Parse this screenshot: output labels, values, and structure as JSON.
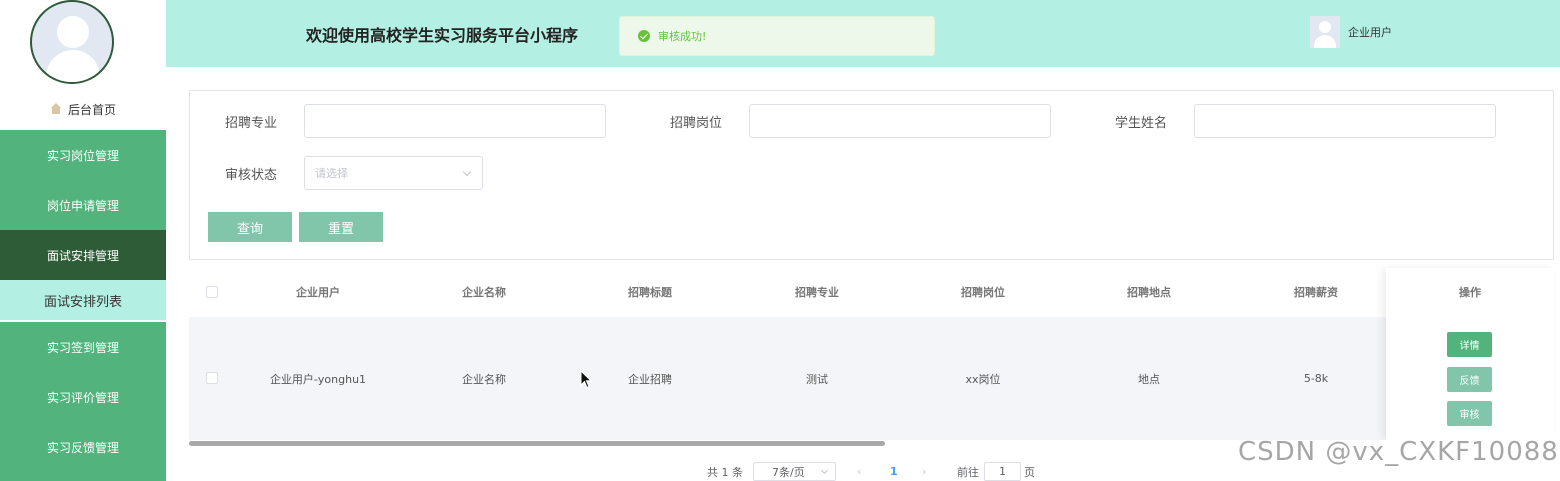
{
  "sidebar": {
    "home_label": "后台首页",
    "items": [
      {
        "label": "实习岗位管理"
      },
      {
        "label": "岗位申请管理"
      },
      {
        "label": "面试安排管理"
      },
      {
        "label": "面试安排列表"
      },
      {
        "label": "实习签到管理"
      },
      {
        "label": "实习评价管理"
      },
      {
        "label": "实习反馈管理"
      }
    ]
  },
  "header": {
    "title": "欢迎使用高校学生实习服务平台小程序",
    "toast": "审核成功!",
    "user_label": "企业用户"
  },
  "search": {
    "major_label": "招聘专业",
    "major_value": "",
    "position_label": "招聘岗位",
    "position_value": "",
    "student_label": "学生姓名",
    "student_value": "",
    "status_label": "审核状态",
    "status_placeholder": "请选择",
    "query_button": "查询",
    "reset_button": "重置"
  },
  "table": {
    "columns": [
      "企业用户",
      "企业名称",
      "招聘标题",
      "招聘专业",
      "招聘岗位",
      "招聘地点",
      "招聘薪资",
      "操作"
    ],
    "rows": [
      {
        "company_user": "企业用户-yonghu1",
        "company_name": "企业名称",
        "title": "企业招聘",
        "major": "测试",
        "position": "xx岗位",
        "location": "地点",
        "salary": "5-8k"
      }
    ],
    "actions": {
      "detail": "详情",
      "feedback": "反馈",
      "review": "审核"
    }
  },
  "pagination": {
    "total": "共 1 条",
    "page_size": "7条/页",
    "current_page": "1",
    "goto_label": "前往",
    "goto_value": "1",
    "page_suffix": "页"
  },
  "colors": {
    "accent": "#52b47c",
    "active": "#2e5c36",
    "header_bg": "#b3f0e3",
    "button": "#81c5aa",
    "detail_button": "#52b47c"
  },
  "watermark": "CSDN @vx_CXKF10088"
}
